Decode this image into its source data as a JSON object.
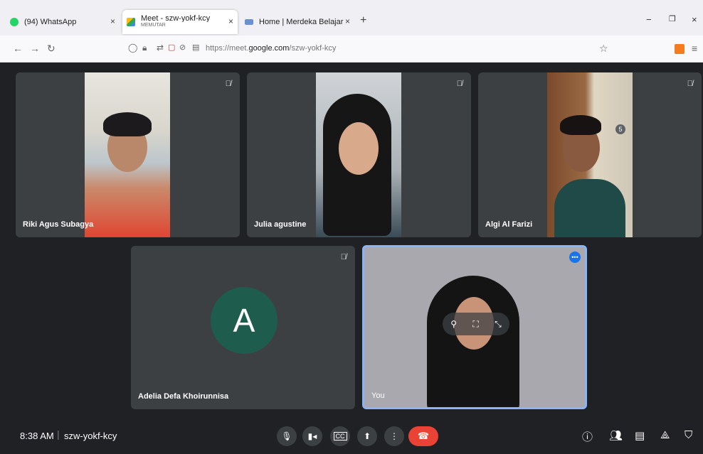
{
  "browser": {
    "tabs": [
      {
        "title": "(94) WhatsApp",
        "close": "×"
      },
      {
        "title": "Meet - szw-yokf-kcy",
        "subtitle": "MEMUTAR",
        "close": "×"
      },
      {
        "title": "Home | Merdeka Belajar - Kamp",
        "close": "×"
      }
    ],
    "new_tab": "+",
    "url_prefix": "https://meet.",
    "url_domain": "google.com",
    "url_path": "/szw-yokf-kcy",
    "window_controls": {
      "minimize": "−",
      "restore": "❐",
      "close": "×"
    }
  },
  "participants": [
    {
      "name": "Riki Agus Subagya",
      "muted": true
    },
    {
      "name": "Julia agustine",
      "muted": true
    },
    {
      "name": "Algi Al Farizi",
      "muted": true
    },
    {
      "name": "Adelia Defa Khoirunnisa",
      "muted": true,
      "avatar_letter": "A",
      "avatar_color": "#1e5c4e"
    },
    {
      "name": "You",
      "muted": false
    }
  ],
  "bottom_bar": {
    "time": "8:38 AM",
    "separator": "|",
    "meeting_code": "szw-yokf-kcy",
    "people_count": "5"
  },
  "colors": {
    "meet_bg": "#202124",
    "tile_bg": "#3c4043",
    "end_call": "#ea4335",
    "active_border": "#8ab4f8"
  },
  "icons": [
    "mic-off-icon",
    "mic-icon",
    "camera-icon",
    "captions-icon",
    "present-icon",
    "more-icon",
    "end-call-icon",
    "info-icon",
    "people-icon",
    "chat-icon",
    "activities-icon",
    "host-controls-icon"
  ]
}
